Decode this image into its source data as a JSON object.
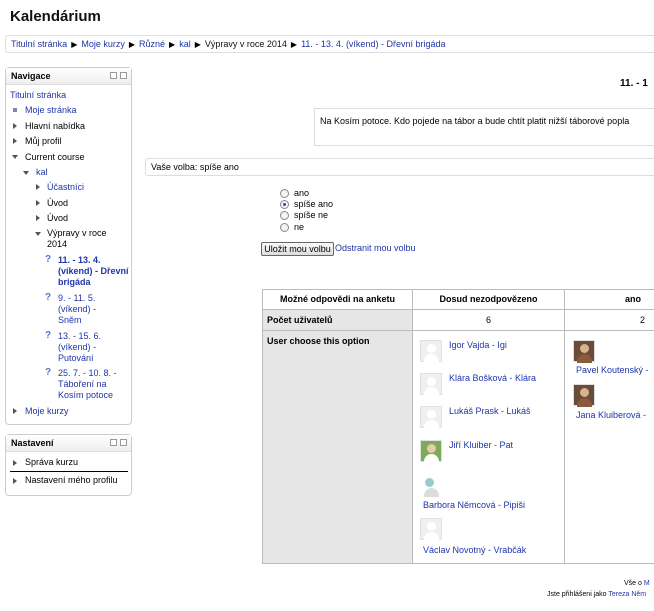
{
  "site_title": "Kalendárium",
  "breadcrumb": [
    "Titulní stránka",
    "Moje kurzy",
    "Různé",
    "kal",
    "Výpravy v roce 2014",
    "11. - 13. 4. (víkend) - Dřevní brigáda"
  ],
  "navigation": {
    "title": "Navigace",
    "home": "Titulní stránka",
    "my_page": "Moje stránka",
    "main_menu": "Hlavní nabídka",
    "profile": "Můj profil",
    "current_course": "Current course",
    "course": "kal",
    "participants": "Účastníci",
    "uvod1": "Úvod",
    "uvod2": "Úvod",
    "section": "Výpravy v roce 2014",
    "activities": [
      {
        "label": "11. - 13. 4. (víkend) - Dřevní brigáda",
        "active": true
      },
      {
        "label": "9. - 11. 5. (víkend) - Sněm",
        "active": false
      },
      {
        "label": "13. - 15. 6. (víkend) - Putování",
        "active": false
      },
      {
        "label": "25. 7. - 10. 8. - Táboření na Kosím potoce",
        "active": false
      }
    ],
    "my_courses": "Moje kurzy"
  },
  "settings": {
    "title": "Nastavení",
    "course_admin": "Správa kurzu",
    "profile_settings": "Nastavení mého profilu"
  },
  "main": {
    "event_title": "11. - 1",
    "description": "Na Kosím potoce. Kdo pojede na tábor a bude chtít platit nižší táborové popla",
    "your_choice": "Vaše volba: spíše ano",
    "options": [
      "ano",
      "spíše ano",
      "spíše ne",
      "ne"
    ],
    "selected_option": "spíše ano",
    "save_button": "Uložit mou volbu",
    "remove_link": "Odstranit mou volbu"
  },
  "results": {
    "col_header": "Možné odpovědi na anketu",
    "row_count_label": "Počet uživatelů",
    "row_users_label": "User choose this option",
    "columns": [
      {
        "name": "Dosud nezodpovězeno",
        "count": "6",
        "users": [
          "Igor Vajda - Igi",
          "Klára Bošková - Klára",
          "Lukáš Prask - Lukáš",
          "Jiří Kluiber - Pat",
          "Barbora Němcová - Pipiši",
          "Václav Novotný - Vrabčák"
        ]
      },
      {
        "name": "ano",
        "count": "2",
        "users": [
          "Pavel Koutenský -",
          "Jana Kluiberová -"
        ]
      }
    ]
  },
  "footer": {
    "line1_prefix": "Vše o",
    "line1_link": "M",
    "line2_prefix": "Jste přihlášeni jako",
    "line2_link": "Tereza Něm"
  }
}
